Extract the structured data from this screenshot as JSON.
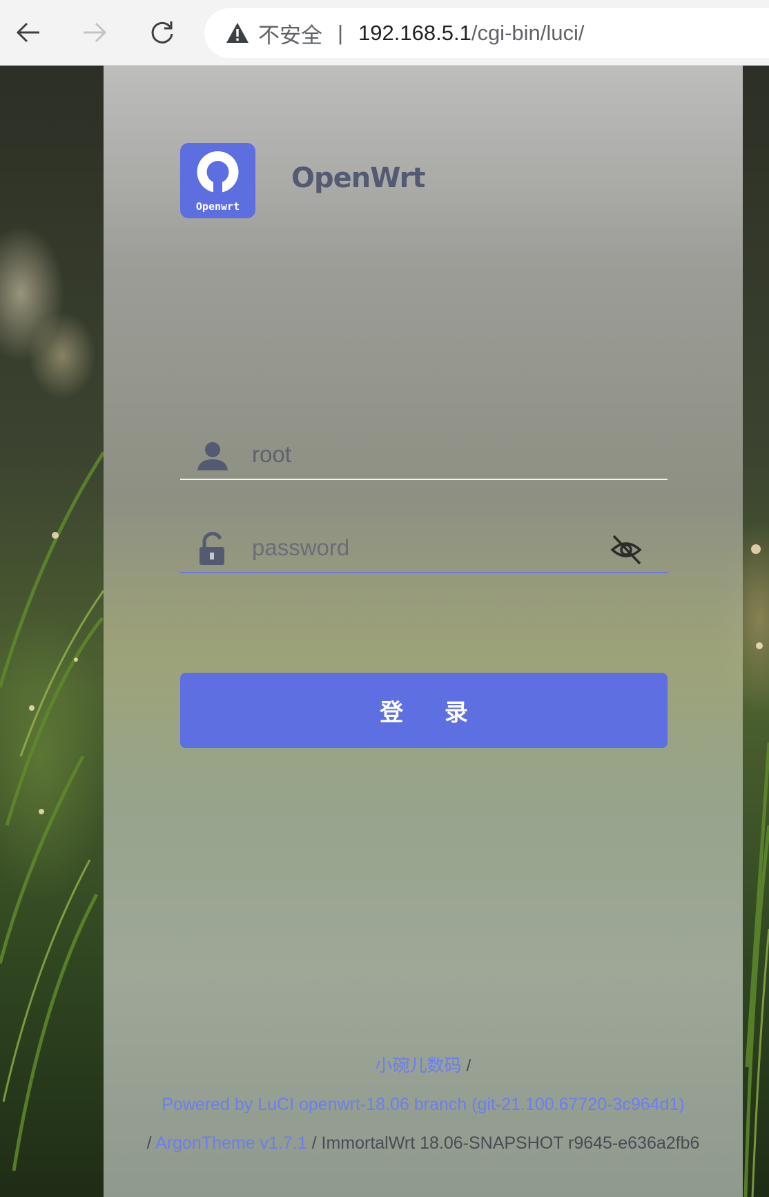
{
  "browser": {
    "insecure_label": "不安全",
    "separator": "|",
    "url_host": "192.168.5.1",
    "url_path": "/cgi-bin/luci/"
  },
  "brand": {
    "logo_text": "Openwrt",
    "title": "OpenWrt",
    "accent_color": "#5e6fe2"
  },
  "login": {
    "username_value": "root",
    "password_placeholder": "password",
    "submit_label": "登 录"
  },
  "footer": {
    "author_link": "小碗儿数码",
    "slash1": " /",
    "powered_by": "Powered by LuCI openwrt-18.06 branch (git-21.100.67720-3c964d1)",
    "slash2": "/ ",
    "theme_link": "ArgonTheme v1.7.1",
    "firmware": " / ImmortalWrt 18.06-SNAPSHOT r9645-e636a2fb6"
  },
  "icons": {
    "back": "arrow-left-icon",
    "forward": "arrow-right-icon",
    "reload": "reload-icon",
    "warning": "warning-triangle-icon",
    "user": "user-icon",
    "lock": "lock-icon",
    "eye": "eye-off-icon"
  }
}
